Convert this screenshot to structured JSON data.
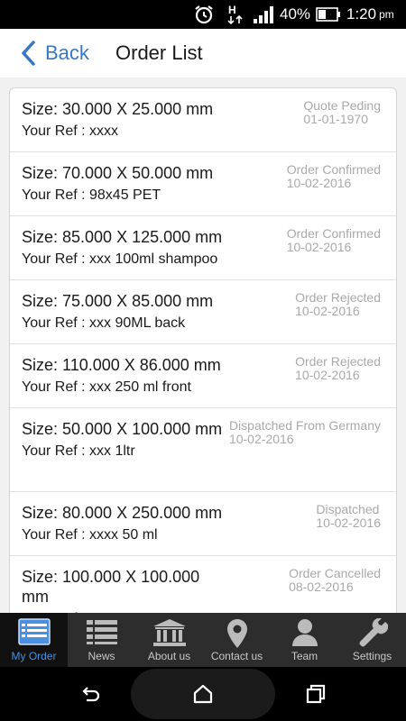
{
  "status_bar": {
    "battery_percent": "40%",
    "time": "1:20",
    "ampm": "pm",
    "network": "H"
  },
  "header": {
    "back_label": "Back",
    "title": "Order List"
  },
  "orders": [
    {
      "size": "Size: 30.000 X 25.000 mm",
      "ref": "Your Ref : xxxx",
      "status": "Quote Peding",
      "date": "01-01-1970"
    },
    {
      "size": "Size: 70.000 X 50.000 mm",
      "ref": "Your Ref : 98x45 PET",
      "status": "Order Confirmed",
      "date": "10-02-2016"
    },
    {
      "size": "Size: 85.000 X 125.000 mm",
      "ref": "Your Ref : xxx 100ml shampoo",
      "status": "Order Confirmed",
      "date": "10-02-2016"
    },
    {
      "size": "Size: 75.000 X 85.000 mm",
      "ref": "Your Ref : xxx 90ML back",
      "status": "Order Rejected",
      "date": "10-02-2016"
    },
    {
      "size": "Size: 110.000 X 86.000 mm",
      "ref": "Your Ref : xxx 250 ml front",
      "status": "Order Rejected",
      "date": "10-02-2016"
    },
    {
      "size": "Size: 50.000 X 100.000 mm",
      "ref": "Your Ref : xxx 1ltr",
      "status": "Dispatched From Germany",
      "date": "10-02-2016"
    },
    {
      "size": "Size: 80.000 X 250.000 mm",
      "ref": "Your Ref : xxxx 50 ml",
      "status": "Dispatched",
      "date": "10-02-2016"
    },
    {
      "size": "Size: 100.000 X 100.000 mm",
      "ref": "Your Ref : test",
      "status": "Order Cancelled",
      "date": "08-02-2016"
    }
  ],
  "tabs": [
    {
      "label": "My Order",
      "icon": "my-order-icon",
      "active": true
    },
    {
      "label": "News",
      "icon": "news-list-icon",
      "active": false
    },
    {
      "label": "About us",
      "icon": "bank-building-icon",
      "active": false
    },
    {
      "label": "Contact us",
      "icon": "location-pin-icon",
      "active": false
    },
    {
      "label": "Team",
      "icon": "person-icon",
      "active": false
    },
    {
      "label": "Settings",
      "icon": "wrench-icon",
      "active": false
    }
  ],
  "colors": {
    "accent": "#3778c4",
    "tab_active": "#4a90e2",
    "status_text": "#a9a9a9"
  }
}
